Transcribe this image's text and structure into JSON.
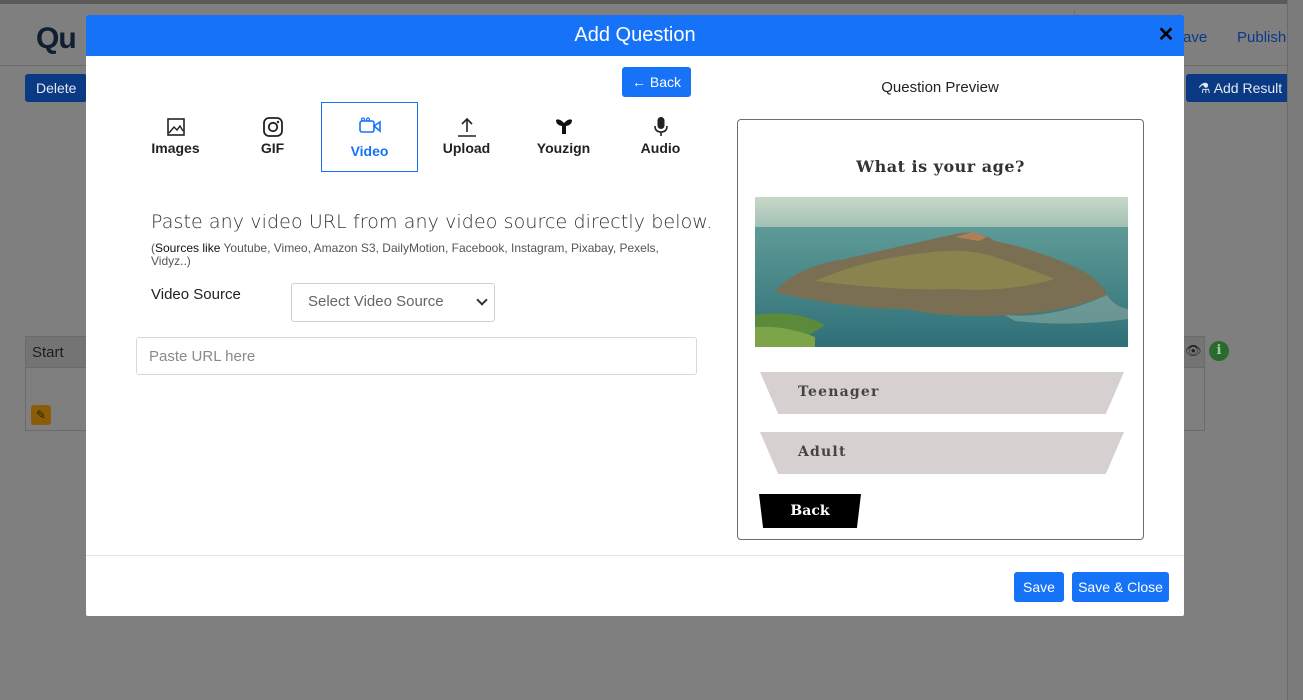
{
  "background": {
    "logo_text": "Qu",
    "nav_save": "ave",
    "nav_publish": "Publish",
    "delete_label": "Delete",
    "add_result_label": "Add Result",
    "table_header_start": "Start"
  },
  "modal": {
    "title": "Add Question",
    "close_glyph": "✕",
    "back_label": "Back",
    "tabs": [
      {
        "label": "Images",
        "icon": "image-icon"
      },
      {
        "label": "GIF",
        "icon": "instagram-icon"
      },
      {
        "label": "Video",
        "icon": "video-icon",
        "active": true
      },
      {
        "label": "Upload",
        "icon": "upload-icon"
      },
      {
        "label": "Youzign",
        "icon": "youzign-icon"
      },
      {
        "label": "Audio",
        "icon": "microphone-icon"
      }
    ],
    "instruction": "Paste any video URL from any video source directly below.",
    "sources_prefix": "Sources like",
    "sources_list": "Youtube, Vimeo, Amazon S3, DailyMotion, Facebook, Instagram, Pixabay, Pexels, Vidyz..",
    "video_source_label": "Video Source",
    "video_source_placeholder": "Select Video Source",
    "url_placeholder": "Paste URL here",
    "preview": {
      "heading": "Question Preview",
      "question": "What is your age?",
      "answers": [
        "Teenager",
        "Adult"
      ],
      "back_label": "Back"
    },
    "footer": {
      "save_label": "Save",
      "save_close_label": "Save & Close"
    }
  },
  "colors": {
    "primary": "#1673f8",
    "overlay": "#7f7f7f",
    "answer_bg": "#d7d0d0"
  }
}
